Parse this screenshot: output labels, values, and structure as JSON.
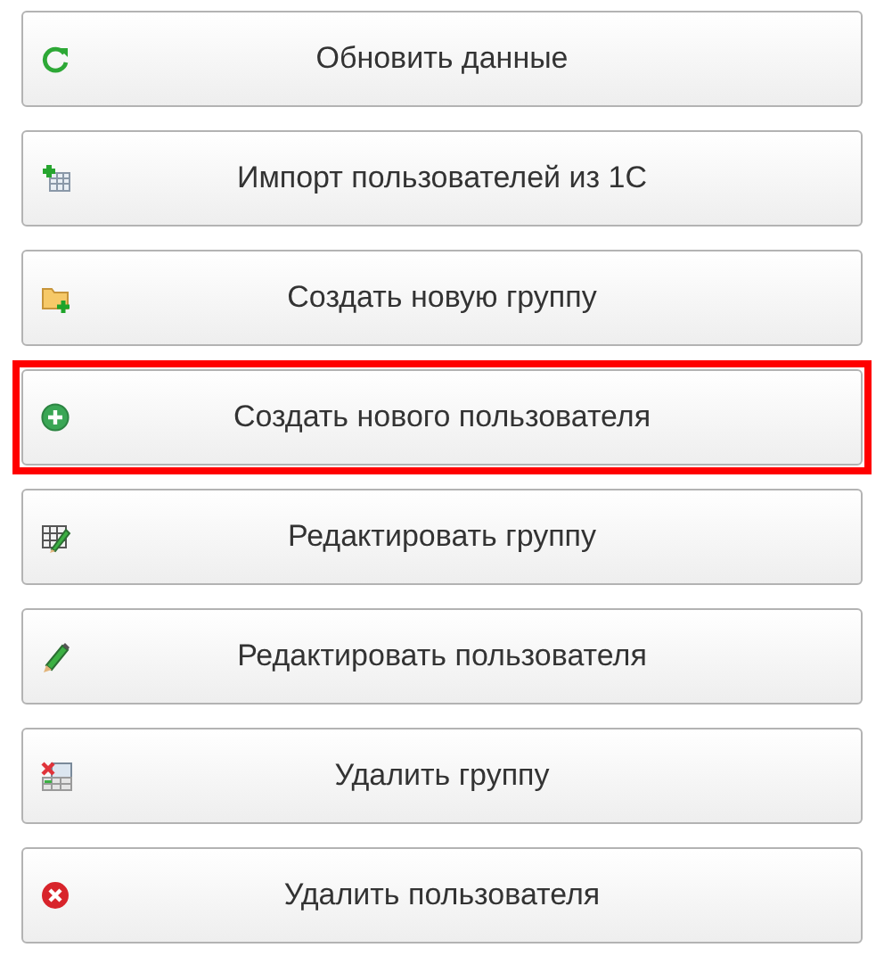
{
  "buttons": [
    {
      "label": "Обновить данные",
      "kind": "refresh",
      "highlighted": false
    },
    {
      "label": "Импорт пользователей из 1С",
      "kind": "import",
      "highlighted": false
    },
    {
      "label": "Создать новую группу",
      "kind": "folderadd",
      "highlighted": false
    },
    {
      "label": "Создать нового пользователя",
      "kind": "add",
      "highlighted": true
    },
    {
      "label": "Редактировать группу",
      "kind": "edittable",
      "highlighted": false
    },
    {
      "label": "Редактировать пользователя",
      "kind": "edit",
      "highlighted": false
    },
    {
      "label": "Удалить группу",
      "kind": "deletetable",
      "highlighted": false
    },
    {
      "label": "Удалить пользователя",
      "kind": "delete",
      "highlighted": false
    }
  ]
}
